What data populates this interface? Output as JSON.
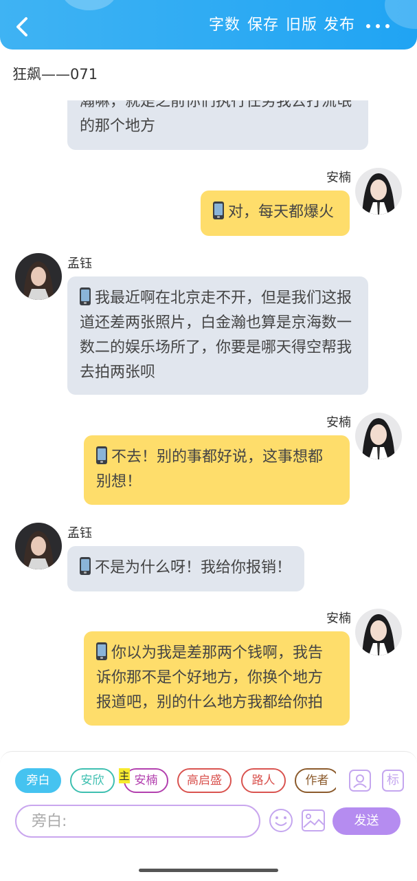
{
  "header": {
    "actions": [
      "字数",
      "保存",
      "旧版",
      "发布"
    ]
  },
  "chapter_title": "狂飙——071",
  "messages": [
    {
      "side": "left",
      "text": "瀚嘛，就是之前你们执行任务我去打流氓的那个地方",
      "partial": true
    },
    {
      "side": "right",
      "name": "安楠",
      "text": "对，每天都爆火"
    },
    {
      "side": "left",
      "name": "孟钰",
      "text": "我最近啊在北京走不开，但是我们这报道还差两张照片，白金瀚也算是京海数一数二的娱乐场所了，你要是哪天得空帮我去拍两张呗"
    },
    {
      "side": "right",
      "name": "安楠",
      "text": "不去！别的事都好说，这事想都别想！"
    },
    {
      "side": "left",
      "name": "孟钰",
      "text": "不是为什么呀！我给你报销！"
    },
    {
      "side": "right",
      "name": "安楠",
      "text": "你以为我是差那两个钱啊，我告诉你那不是个好地方，你换个地方报道吧，别的什么地方我都给你拍"
    }
  ],
  "roles": [
    {
      "label": "旁白",
      "selected": true,
      "color": "#45c3f0"
    },
    {
      "label": "安欣",
      "color": "#3dbfb0"
    },
    {
      "label": "安楠",
      "color": "#b23fae"
    },
    {
      "label": "高启盛",
      "color": "#d9534f"
    },
    {
      "label": "路人",
      "color": "#d9534f"
    },
    {
      "label": "作者",
      "color": "#8b5a2b"
    }
  ],
  "main_badge": "主",
  "composer": {
    "placeholder": "旁白:",
    "send_label": "发送",
    "tag_button": "标"
  }
}
